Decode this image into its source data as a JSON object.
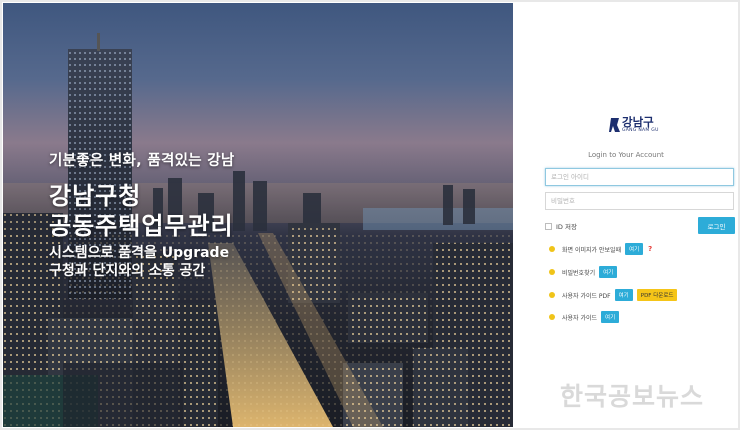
{
  "hero": {
    "tagline": "기분좋은 변화, 품격있는 강남",
    "title_line1": "강남구청",
    "title_line2": "공동주택업무관리",
    "sub_line1": "시스템으로 품격을 Upgrade",
    "sub_line2": "구청과 단지와의 소통 공간"
  },
  "logo": {
    "name": "강남구",
    "english": "GANG NAM GU"
  },
  "login": {
    "subtitle": "Login to Your Account",
    "id_placeholder": "로그인 아이디",
    "pw_placeholder": "비밀번호",
    "save_id_label": "ID 저장",
    "login_button": "로그인"
  },
  "help": [
    {
      "label": "화면 이미지가 안보일때",
      "button": "여기",
      "extra": "?"
    },
    {
      "label": "비밀번호찾기",
      "button": "여기"
    },
    {
      "label": "사용자 가이드 PDF",
      "button": "여기",
      "extra_button": "PDF 다운로드"
    },
    {
      "label": "사용자 가이드",
      "button": "여기"
    }
  ],
  "watermark": "한국공보뉴스",
  "colors": {
    "accent": "#2dacd8",
    "bullet": "#f0c419",
    "pdf": "#f5c518",
    "brand": "#1d2f6f"
  }
}
